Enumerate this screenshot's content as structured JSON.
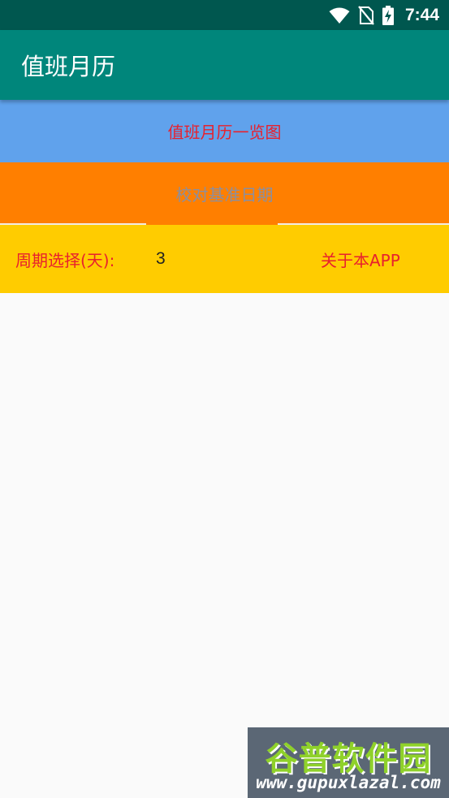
{
  "status_bar": {
    "time": "7:44",
    "icons": [
      "wifi-icon",
      "no-sim-icon",
      "battery-charging-icon"
    ]
  },
  "app_bar": {
    "title": "值班月历",
    "color": "#00867b"
  },
  "buttons": {
    "calendar_overview": "值班月历一览图",
    "calibrate_date": "校对基准日期"
  },
  "period": {
    "label": "周期选择(天):",
    "value": "3"
  },
  "about": {
    "label": "关于本APP"
  },
  "watermark": {
    "title": "谷普软件园",
    "url": "www.gupuxlazal.com"
  },
  "colors": {
    "status_bar": "#00574f",
    "accent_blue": "#60a2ec",
    "accent_orange": "#ff7f00",
    "accent_yellow": "#ffcc00",
    "text_red": "#e8212d"
  }
}
